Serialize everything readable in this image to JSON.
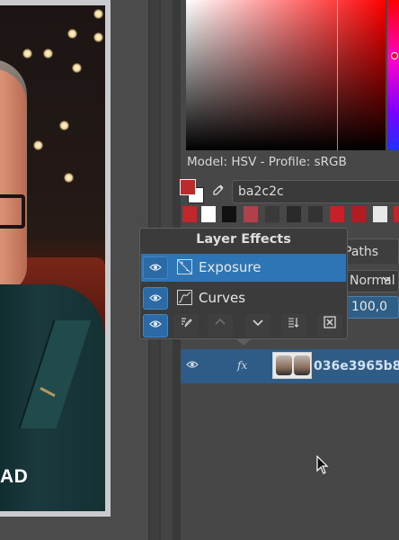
{
  "canvas": {
    "caption_text": "AD"
  },
  "color_selector": {
    "model_label": "Model: HSV - Profile: sRGB",
    "hex_value": "ba2c2c",
    "foreground_color": "#ba2c2c",
    "background_color": "#ffffff",
    "recent_colors": [
      "#c0272d",
      "#ffffff",
      "#111111",
      "#b0404a",
      "#3a3a3a",
      "#2a2a2a",
      "#333333",
      "#c8202a",
      "#b01c22",
      "#e8e8e8",
      "#c0272d"
    ]
  },
  "layers_docker": {
    "paths_tab_label": "Paths",
    "blend_mode": "Normal",
    "opacity_value": "100,0",
    "layer": {
      "name": "036e3965b8",
      "fx_label": "fx"
    }
  },
  "layer_effects_popup": {
    "title": "Layer Effects",
    "effects": [
      {
        "label": "Exposure",
        "selected": true,
        "icon": "exposure-icon"
      },
      {
        "label": "Curves",
        "selected": false,
        "icon": "curves-icon"
      }
    ],
    "toolbar_icons": [
      "eye-icon",
      "edit-icon",
      "move-up-icon",
      "move-down-icon",
      "sort-icon",
      "delete-icon"
    ]
  },
  "colors": {
    "selection_blue": "#2e75b6",
    "layer_row_blue": "#2e5c86",
    "panel_bg": "#474747"
  }
}
